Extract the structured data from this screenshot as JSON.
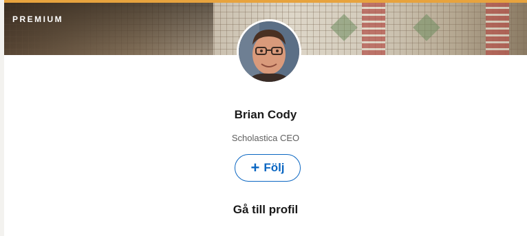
{
  "banner": {
    "badge_label": "PREMIUM",
    "accent_color": "#e7a33e"
  },
  "profile": {
    "name": "Brian Cody",
    "headline": "Scholastica CEO"
  },
  "actions": {
    "follow_icon": "+",
    "follow_label": "Följ",
    "follow_color": "#0a66c2",
    "profile_link_label": "Gå till profil"
  },
  "icons": {
    "follow": "plus-icon"
  }
}
